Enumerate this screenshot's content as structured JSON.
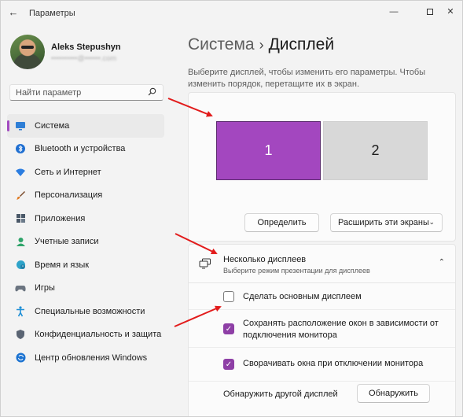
{
  "window": {
    "title": "Параметры",
    "back_icon": "back-arrow-icon",
    "min_glyph": "—",
    "close_glyph": "✕"
  },
  "user": {
    "name": "Aleks Stepushyn",
    "email": "••••••••••@••••••.com"
  },
  "search": {
    "placeholder": "Найти параметр",
    "icon": "search-icon"
  },
  "nav": {
    "items": [
      {
        "label": "Система",
        "icon": "system-icon",
        "active": true
      },
      {
        "label": "Bluetooth и устройства",
        "icon": "bluetooth-icon"
      },
      {
        "label": "Сеть и Интернет",
        "icon": "wifi-icon"
      },
      {
        "label": "Персонализация",
        "icon": "brush-icon"
      },
      {
        "label": "Приложения",
        "icon": "apps-icon"
      },
      {
        "label": "Учетные записи",
        "icon": "account-icon"
      },
      {
        "label": "Время и язык",
        "icon": "globe-icon"
      },
      {
        "label": "Игры",
        "icon": "gamepad-icon"
      },
      {
        "label": "Специальные возможности",
        "icon": "accessibility-icon"
      },
      {
        "label": "Конфиденциальность и защита",
        "icon": "shield-icon"
      },
      {
        "label": "Центр обновления Windows",
        "icon": "update-icon"
      }
    ]
  },
  "breadcrumb": {
    "parent": "Система",
    "separator": "›",
    "current": "Дисплей"
  },
  "description": "Выберите дисплей, чтобы изменить его параметры. Чтобы изменить порядок, перетащите их в экран.",
  "displays": {
    "monitors": [
      {
        "label": "1",
        "selected": true
      },
      {
        "label": "2",
        "selected": false
      }
    ],
    "identify_label": "Определить",
    "extend_label": "Расширить эти экраны",
    "accent": "#a347bf"
  },
  "multiple": {
    "title": "Несколько дисплеев",
    "subtitle": "Выберите режим презентации для дисплеев",
    "options": [
      {
        "label": "Сделать основным дисплеем",
        "checked": false
      },
      {
        "label": "Сохранять расположение окон в зависимости от подключения монитора",
        "checked": true
      },
      {
        "label": "Сворачивать окна при отключении монитора",
        "checked": true
      }
    ],
    "detect_label": "Обнаружить другой дисплей",
    "detect_button": "Обнаружить"
  },
  "colors": {
    "accent": "#8e3fa6",
    "annotation_arrow": "#e21b1b"
  }
}
